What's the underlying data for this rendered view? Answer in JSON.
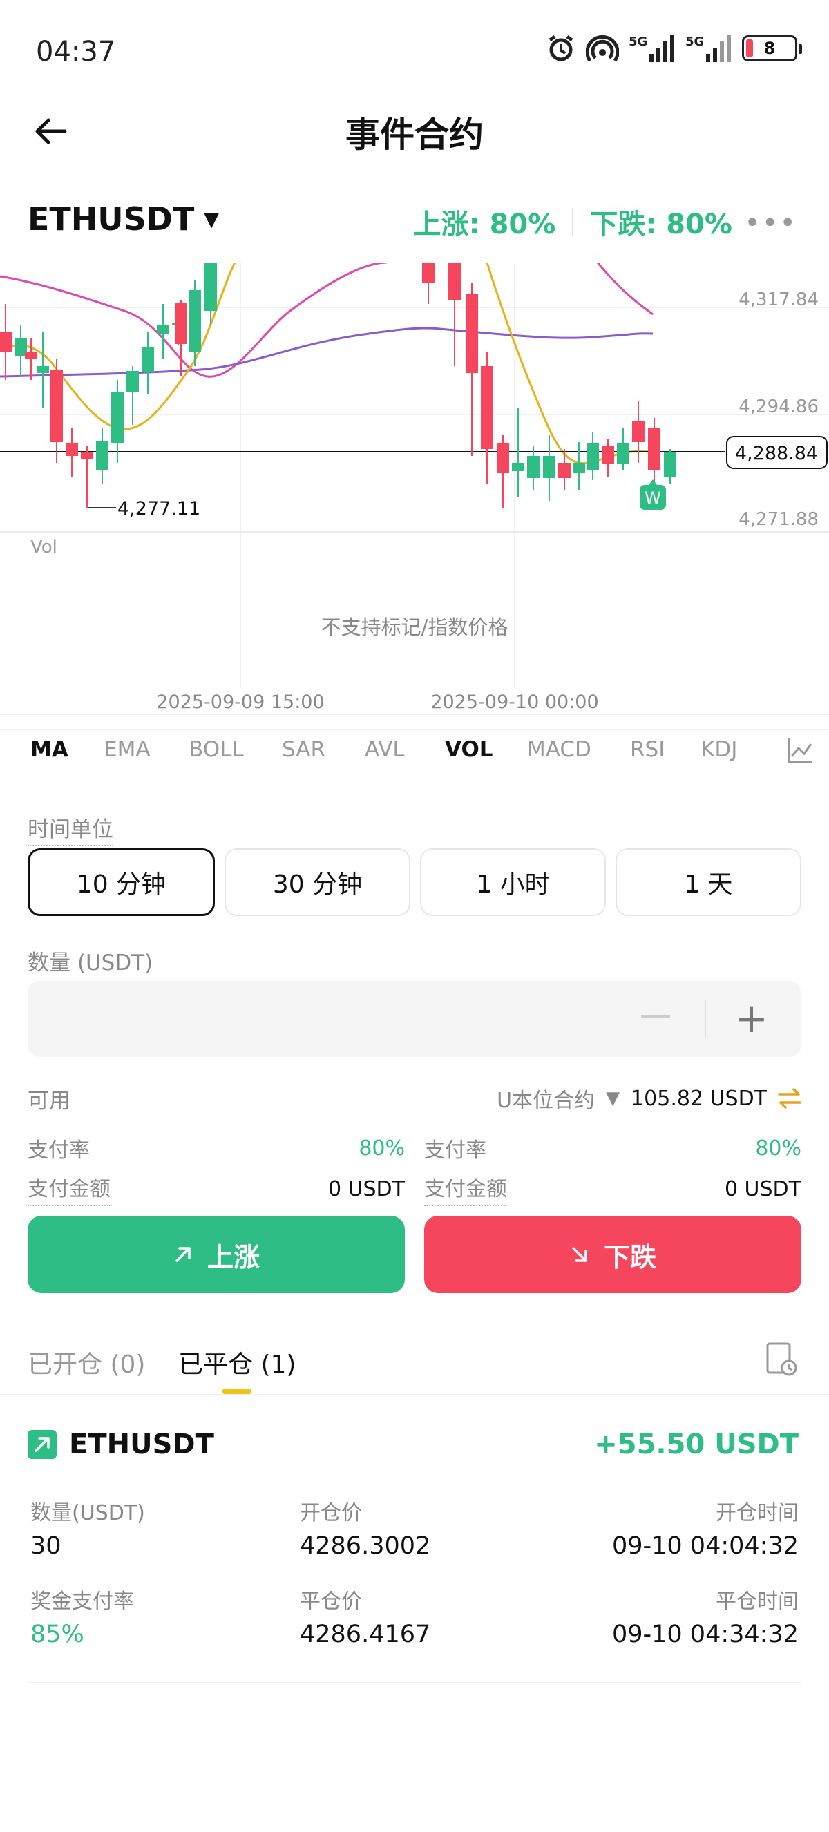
{
  "status_bar": {
    "time": "04:37",
    "battery": "8"
  },
  "header": {
    "title": "事件合约"
  },
  "symbol_row": {
    "symbol": "ETHUSDT",
    "up_rate": "上涨: 80%",
    "down_rate": "下跌: 80%"
  },
  "chart": {
    "price_levels": [
      "4,317.84",
      "4,294.86",
      "4,271.88"
    ],
    "current_price": "4,288.84",
    "low_marker": "4,277.11",
    "vol_label": "Vol",
    "vol_notice": "不支持标记/指数价格",
    "time_labels": [
      "2025-09-09 15:00",
      "2025-09-10 00:00"
    ],
    "badge": "W",
    "colors": {
      "up": "#2ebd85",
      "down": "#f6465d",
      "ma_yellow": "#e8b21a",
      "ma_pink": "#d84bb0",
      "ma_purple": "#8a5bc9"
    }
  },
  "indicators": [
    "MA",
    "EMA",
    "BOLL",
    "SAR",
    "AVL",
    "VOL",
    "MACD",
    "RSI",
    "KDJ"
  ],
  "time_unit": {
    "label": "时间单位",
    "options": [
      "10 分钟",
      "30 分钟",
      "1 小时",
      "1 天"
    ],
    "selected": "10 分钟"
  },
  "quantity": {
    "label": "数量 (USDT)",
    "minus": "—",
    "plus": "+"
  },
  "available": {
    "label": "可用",
    "contract_type": "U本位合约",
    "amount": "105.82 USDT"
  },
  "pay_left": {
    "rate_label": "支付率",
    "rate": "80%",
    "amount_label": "支付金额",
    "amount": "0 USDT"
  },
  "pay_right": {
    "rate_label": "支付率",
    "rate": "80%",
    "amount_label": "支付金额",
    "amount": "0 USDT"
  },
  "actions": {
    "up": "上涨",
    "down": "下跌"
  },
  "position_tabs": {
    "open": "已开仓 (0)",
    "closed": "已平仓 (1)"
  },
  "closed_position": {
    "symbol": "ETHUSDT",
    "pnl": "+55.50 USDT",
    "qty_label": "数量(USDT)",
    "qty": "30",
    "open_price_label": "开仓价",
    "open_price": "4286.3002",
    "open_time_label": "开仓时间",
    "open_time": "09-10 04:04:32",
    "payout_label": "奖金支付率",
    "payout": "85%",
    "close_price_label": "平仓价",
    "close_price": "4286.4167",
    "close_time_label": "平仓时间",
    "close_time": "09-10 04:34:32"
  }
}
